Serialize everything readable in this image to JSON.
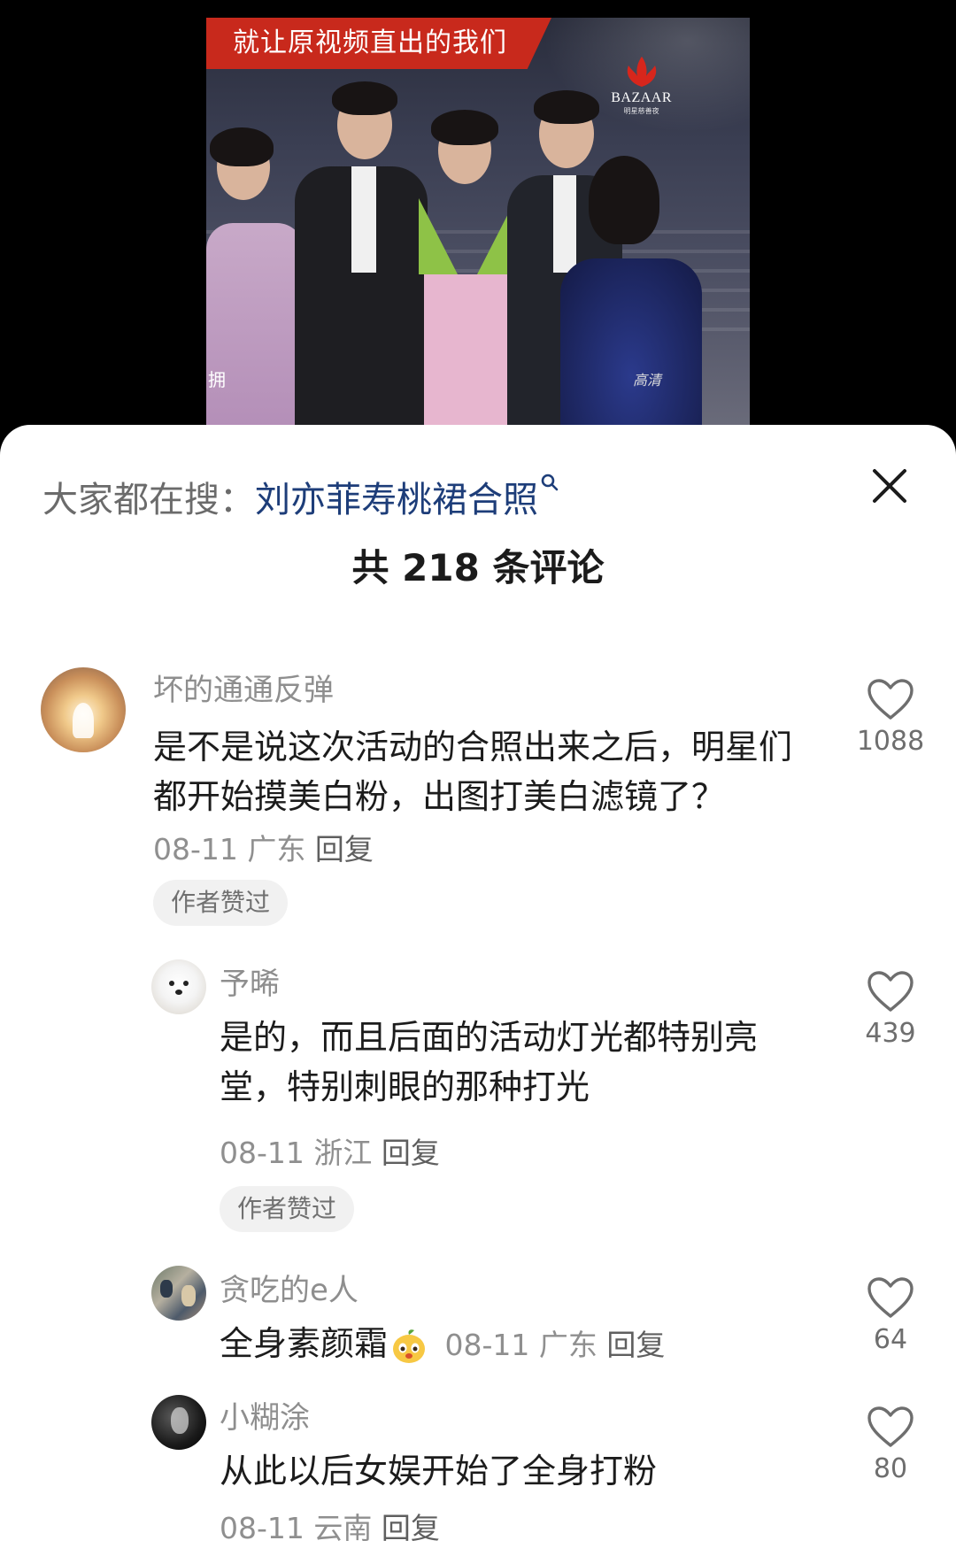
{
  "video": {
    "banner_text": "就让原视频直出的我们",
    "logo_text": "BAZAAR",
    "logo_sub": "明星慈善夜",
    "corner_text": "拥",
    "hd_text": "高清"
  },
  "header": {
    "search_prefix": "大家都在搜：",
    "search_term": "刘亦菲寿桃裙合照",
    "comment_count_title": "共 218 条评论"
  },
  "comments": [
    {
      "username": "坏的通通反弹",
      "text": "是不是说这次活动的合照出来之后，明星们都开始摸美白粉，出图打美白滤镜了？",
      "date": "08-11",
      "location": "广东",
      "reply_label": "回复",
      "badge": "作者赞过",
      "likes": "1088"
    },
    {
      "username": "予晞",
      "text": "是的，而且后面的活动灯光都特别亮堂，特别刺眼的那种打光",
      "date": "08-11",
      "location": "浙江",
      "reply_label": "回复",
      "badge": "作者赞过",
      "likes": "439"
    },
    {
      "username": "贪吃的e人",
      "text": "全身素颜霜",
      "emoji": "mango-face-emoji",
      "date": "08-11",
      "location": "广东",
      "reply_label": "回复",
      "likes": "64"
    },
    {
      "username": "小糊涂",
      "text": "从此以后女娱开始了全身打粉",
      "date": "08-11",
      "location": "云南",
      "reply_label": "回复",
      "likes": "80"
    }
  ],
  "colors": {
    "banner": "#c8291c",
    "search_term": "#1d3d79",
    "meta_gray": "#8f8f8f",
    "badge_bg": "#f1f1f1"
  },
  "icons": [
    "close-icon",
    "search-icon",
    "heart-icon",
    "bazaar-logo-icon"
  ]
}
